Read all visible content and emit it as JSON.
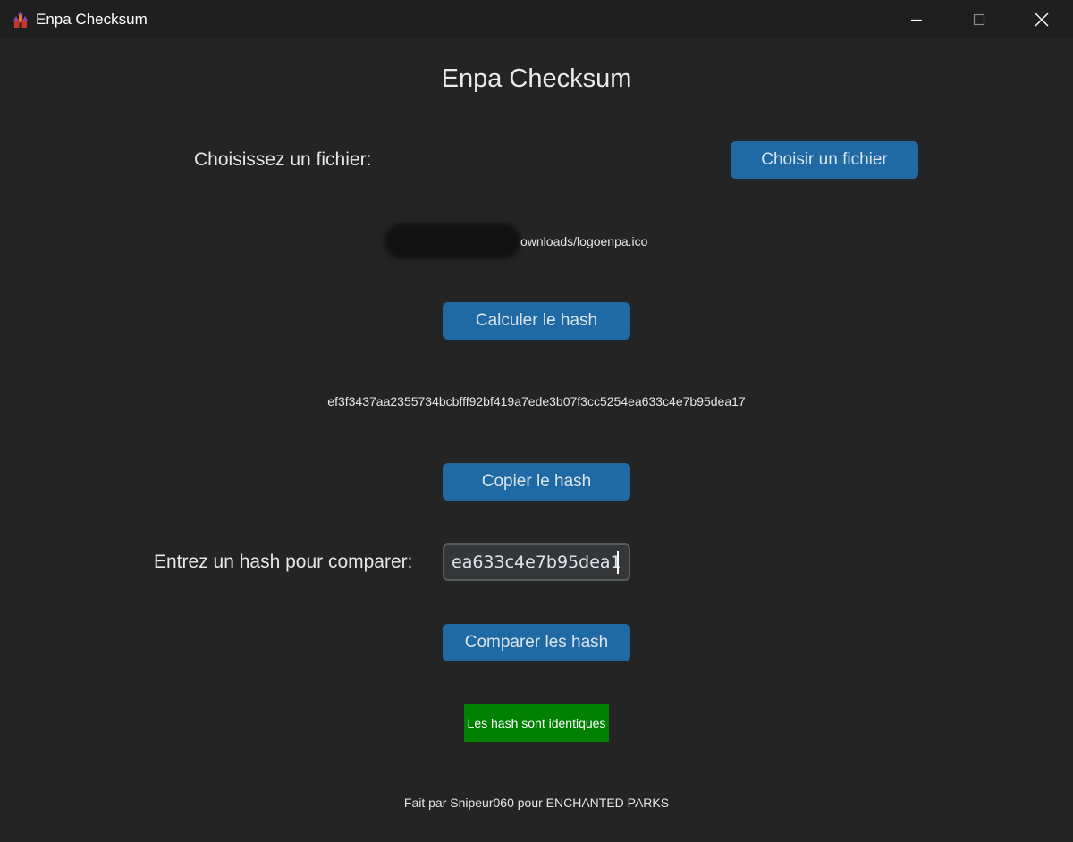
{
  "window": {
    "title": "Enpa Checksum",
    "icon": "castle-icon"
  },
  "app": {
    "heading": "Enpa Checksum"
  },
  "file": {
    "label": "Choisissez un fichier:",
    "button_label": "Choisir un fichier",
    "path_visible": "ownloads/logoenpa.ico"
  },
  "hash": {
    "compute_button_label": "Calculer le hash",
    "value": "ef3f3437aa2355734bcbfff92bf419a7ede3b07f3cc5254ea633c4e7b95dea17",
    "copy_button_label": "Copier le hash"
  },
  "compare": {
    "label": "Entrez un hash pour comparer:",
    "input_value": "ea633c4e7b95dea17",
    "button_label": "Comparer les hash",
    "result_text": "Les hash sont identiques",
    "result_color": "#008000"
  },
  "footer": {
    "text": "Fait par Snipeur060 pour ENCHANTED PARKS"
  },
  "colors": {
    "background": "#242424",
    "button": "#1f6aa5"
  }
}
